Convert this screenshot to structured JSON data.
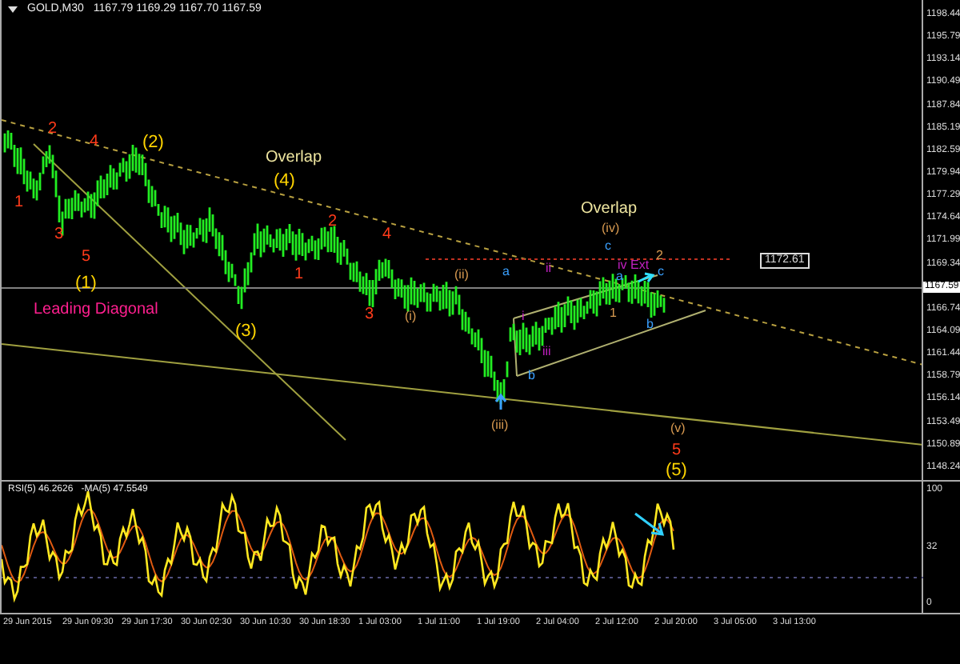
{
  "header": {
    "symbol": "GOLD,M30",
    "ohlc": "1167.79 1169.29 1167.70 1167.59"
  },
  "price_axis": [
    "1198.44",
    "1195.79",
    "1193.14",
    "1190.49",
    "1187.84",
    "1185.19",
    "1182.59",
    "1179.94",
    "1177.29",
    "1174.64",
    "1171.99",
    "1169.34",
    "1166.74",
    "1164.09",
    "1161.44",
    "1158.79",
    "1156.14",
    "1153.49",
    "1150.89",
    "1148.24"
  ],
  "current_price": "1167.59",
  "level_marker": "1172.61",
  "wave_labels": [
    {
      "text": "1",
      "kind": "intermediate"
    },
    {
      "text": "2",
      "kind": "intermediate"
    },
    {
      "text": "3",
      "kind": "intermediate"
    },
    {
      "text": "4",
      "kind": "intermediate"
    },
    {
      "text": "5",
      "kind": "intermediate"
    },
    {
      "text": "(1)",
      "kind": "primary"
    },
    {
      "text": "(2)",
      "kind": "primary"
    },
    {
      "text": "Leading Diagonal",
      "kind": "title"
    },
    {
      "text": "Overlap",
      "kind": "note"
    },
    {
      "text": "(4)",
      "kind": "primary"
    },
    {
      "text": "(3)",
      "kind": "primary"
    },
    {
      "text": "2",
      "kind": "intermediate"
    },
    {
      "text": "1",
      "kind": "intermediate"
    },
    {
      "text": "4",
      "kind": "intermediate"
    },
    {
      "text": "3",
      "kind": "intermediate"
    },
    {
      "text": "(i)",
      "kind": "minor"
    },
    {
      "text": "(ii)",
      "kind": "minor"
    },
    {
      "text": "a",
      "kind": "abc"
    },
    {
      "text": "b",
      "kind": "abc"
    },
    {
      "text": "(iii)",
      "kind": "minor"
    },
    {
      "text": "Overlap",
      "kind": "note"
    },
    {
      "text": "(iv)",
      "kind": "minor"
    },
    {
      "text": "c",
      "kind": "abc"
    },
    {
      "text": "2",
      "kind": "minor"
    },
    {
      "text": "iv Ext",
      "kind": "sub"
    },
    {
      "text": "c",
      "kind": "abc"
    },
    {
      "text": "ii",
      "kind": "sub"
    },
    {
      "text": "i",
      "kind": "sub"
    },
    {
      "text": "iii",
      "kind": "sub"
    },
    {
      "text": "1",
      "kind": "minor"
    },
    {
      "text": "b",
      "kind": "abc"
    },
    {
      "text": "a",
      "kind": "abc"
    },
    {
      "text": "(v)",
      "kind": "minor"
    },
    {
      "text": "5",
      "kind": "intermediate"
    },
    {
      "text": "(5)",
      "kind": "primary"
    }
  ],
  "indicator": {
    "rsi": "RSI(5) 46.2626",
    "ma": "-MA(5) 47.5549",
    "axis": [
      "100",
      "32",
      "0"
    ]
  },
  "time_axis": [
    "29 Jun 2015",
    "29 Jun 09:30",
    "29 Jun 17:30",
    "30 Jun 02:30",
    "30 Jun 10:30",
    "30 Jun 18:30",
    "1 Jul 03:00",
    "1 Jul 11:00",
    "1 Jul 19:00",
    "2 Jul 04:00",
    "2 Jul 12:00",
    "2 Jul 20:00",
    "3 Jul 05:00",
    "3 Jul 13:00"
  ]
}
